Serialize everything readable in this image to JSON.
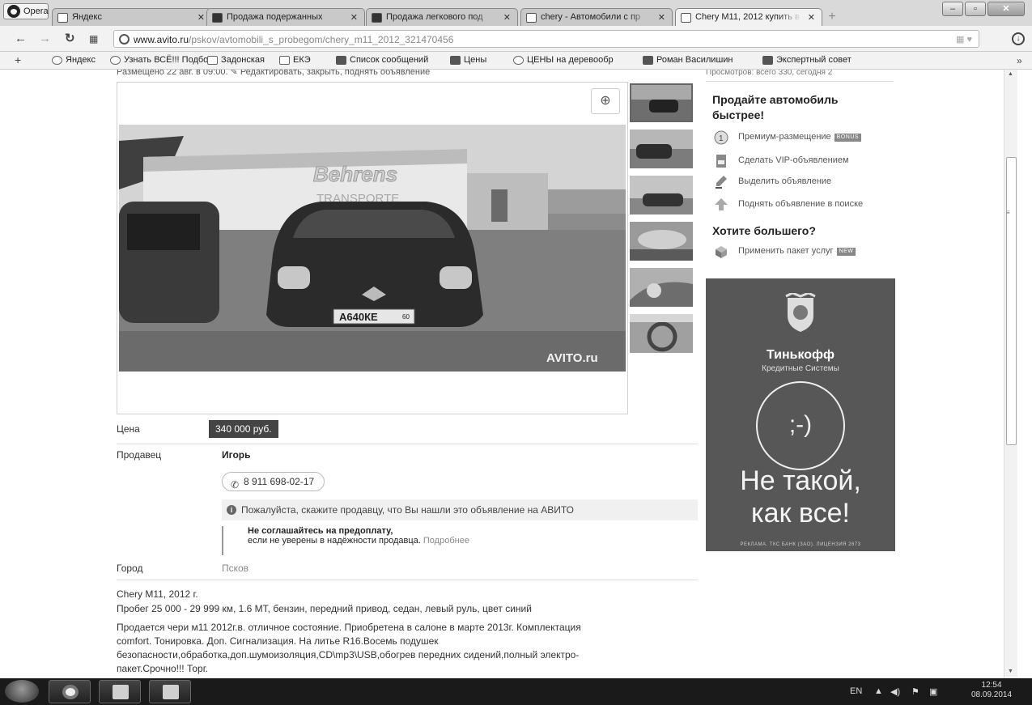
{
  "browser": {
    "menu_label": "Opera",
    "tabs": [
      {
        "title": "Яндекс",
        "active": false
      },
      {
        "title": "Продажа подержанных",
        "active": false
      },
      {
        "title": "Продажа легкового под",
        "active": false
      },
      {
        "title": "chery - Автомобили с пр",
        "active": false
      },
      {
        "title": "Chery M11, 2012 купить в",
        "active": true
      }
    ],
    "url_domain": "www.avito.ru",
    "url_path": "/pskov/avtomobili_s_probegom/chery_m11_2012_321470456",
    "bookmarks": [
      "Яндекс",
      "Узнать ВСЁ!!! Подбо",
      "Задонская",
      "ЕКЭ",
      "Список сообщений",
      "Цены",
      "ЦЕНЫ на деревообр",
      "Роман Василишин",
      "Экспертный совет"
    ],
    "overflow_label": "»"
  },
  "listing": {
    "posted_line": "Размещено 22 авг. в 09:00. ✎ Редактировать, закрыть, поднять объявление",
    "watermark": "AVITO.ru",
    "price_label": "Цена",
    "price_value": "340 000 руб.",
    "seller_label": "Продавец",
    "seller_name": "Игорь",
    "phone": "8 911 698-02-17",
    "notice": "Пожалуйста, скажите продавцу, что Вы нашли это объявление на АВИТО",
    "warning_bold": "Не соглашайтесь на предоплату,",
    "warning_text": "если не уверены в надёжности продавца.",
    "warning_link": "Подробнее",
    "city_label": "Город",
    "city_value": "Псков",
    "model_line": "Chery M11, 2012 г.",
    "specs_line": "Пробег 25 000 - 29 999 км, 1.6 MT, бензин, передний привод, седан, левый руль, цвет синий",
    "description": [
      "Продается чери м11 2012г.в. отличное состояние. Приобретена в салоне в марте 2013г. Комплектация",
      "comfort. Тонировка. Доп. Сигнализация. На литье R16.Восемь подушек",
      "безопасности,обработка,доп.шумоизоляция,CD\\mp3\\USB,обогрев передних сидений,полный электро-",
      "пакет.Срочно!!! Торг."
    ]
  },
  "sidebar": {
    "views": "Просмотров: всего 330, сегодня 2",
    "sell_title": "Продайте автомобиль быстрее!",
    "items": [
      {
        "label": "Премиум-размещение",
        "badge": "BONUS",
        "icon": "premium-icon"
      },
      {
        "label": "Сделать VIP-объявлением",
        "badge": "",
        "icon": "vip-icon"
      },
      {
        "label": "Выделить объявление",
        "badge": "",
        "icon": "highlight-icon"
      },
      {
        "label": "Поднять объявление в поиске",
        "badge": "",
        "icon": "lift-icon"
      }
    ],
    "more_title": "Хотите большего?",
    "package": {
      "label": "Применить пакет услуг",
      "badge": "NEW"
    },
    "ad": {
      "brand": "Тинькофф",
      "brand_sub": "Кредитные Системы",
      "smile": ";-)",
      "slogan_1": "Не такой,",
      "slogan_2": "как все!",
      "legal": "РЕКЛАМА. ТКС БАНК (ЗАО). ЛИЦЕНЗИЯ 2673"
    }
  },
  "taskbar": {
    "lang": "EN",
    "time": "12:54",
    "date": "08.09.2014"
  }
}
